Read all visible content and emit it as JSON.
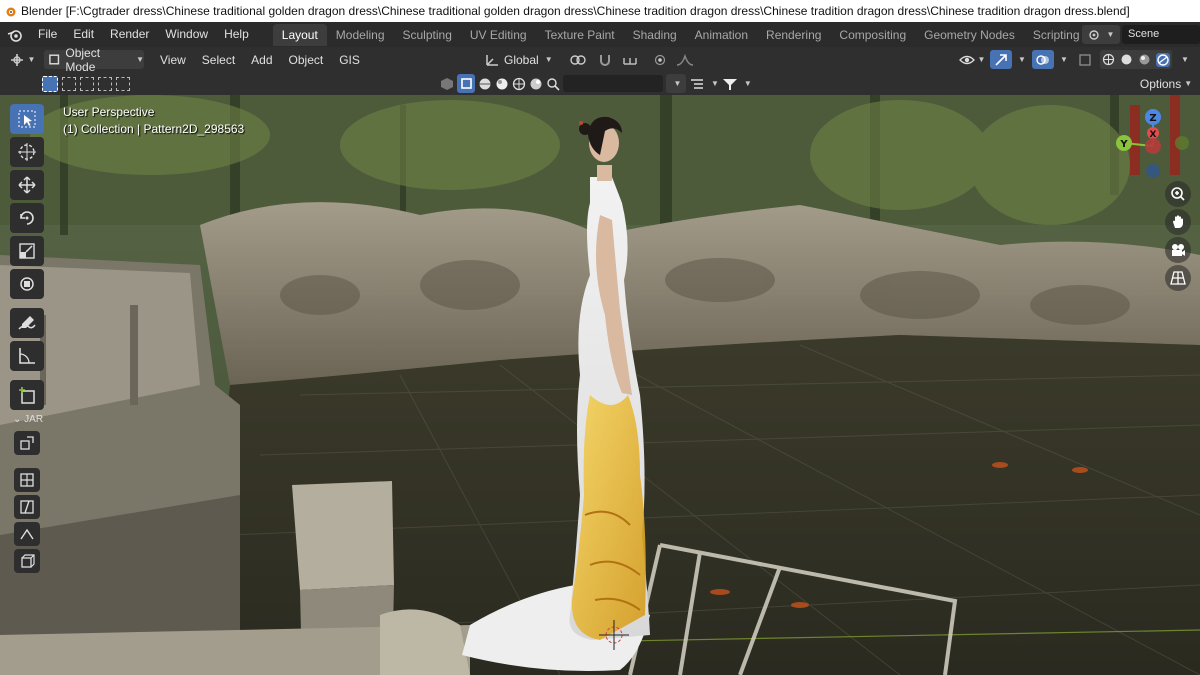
{
  "window": {
    "title": "Blender [F:\\Cgtrader dress\\Chinese traditional golden dragon dress\\Chinese traditional golden dragon dress\\Chinese tradition dragon dress\\Chinese tradition dragon dress\\Chinese tradition dragon dress.blend]"
  },
  "menu": {
    "items": [
      "File",
      "Edit",
      "Render",
      "Window",
      "Help"
    ]
  },
  "workspaces": {
    "tabs": [
      "Layout",
      "Modeling",
      "Sculpting",
      "UV Editing",
      "Texture Paint",
      "Shading",
      "Animation",
      "Rendering",
      "Compositing",
      "Geometry Nodes",
      "Scripting"
    ],
    "active": "Layout"
  },
  "scene": {
    "name": "Scene"
  },
  "header": {
    "mode": "Object Mode",
    "menus": [
      "View",
      "Select",
      "Add",
      "Object",
      "GIS"
    ],
    "transform_orientation": "Global",
    "options_label": "Options"
  },
  "viewport": {
    "perspective": "User Perspective",
    "collection_info": "(1) Collection | Pattern2D_298563"
  },
  "toolbar": {
    "tools": [
      "select-box",
      "cursor",
      "move",
      "rotate",
      "scale",
      "transform",
      "annotate",
      "measure",
      "add-cube"
    ],
    "section_label": "JAR"
  },
  "gizmo": {
    "x": "X",
    "y": "Y",
    "z": "Z"
  },
  "colors": {
    "accent": "#4772b3",
    "axis_x": "#e44c4c",
    "axis_y": "#8ac33c",
    "axis_z": "#4c87e4"
  }
}
